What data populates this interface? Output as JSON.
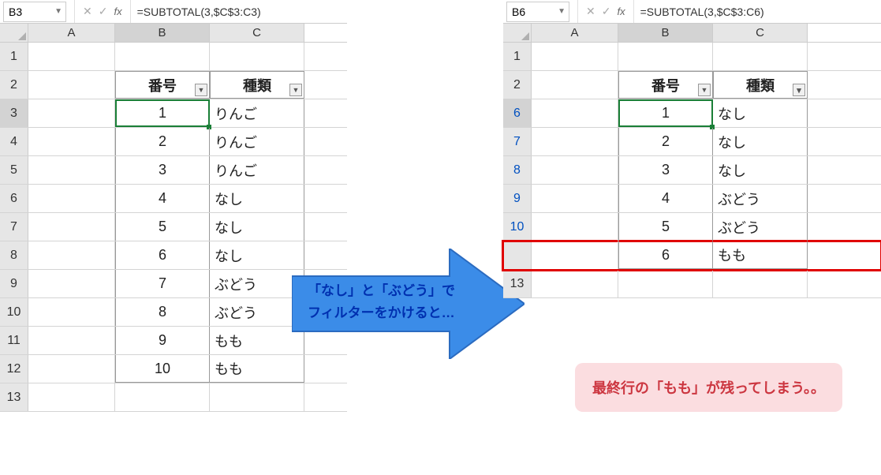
{
  "left": {
    "cellRef": "B3",
    "formula": "=SUBTOTAL(3,$C$3:C3)",
    "headers": {
      "num": "番号",
      "type": "種類"
    },
    "rows": [
      {
        "r": "3",
        "n": "1",
        "t": "りんご"
      },
      {
        "r": "4",
        "n": "2",
        "t": "りんご"
      },
      {
        "r": "5",
        "n": "3",
        "t": "りんご"
      },
      {
        "r": "6",
        "n": "4",
        "t": "なし"
      },
      {
        "r": "7",
        "n": "5",
        "t": "なし"
      },
      {
        "r": "8",
        "n": "6",
        "t": "なし"
      },
      {
        "r": "9",
        "n": "7",
        "t": "ぶどう"
      },
      {
        "r": "10",
        "n": "8",
        "t": "ぶどう"
      },
      {
        "r": "11",
        "n": "9",
        "t": "もも"
      },
      {
        "r": "12",
        "n": "10",
        "t": "もも"
      }
    ],
    "emptyRow": "13"
  },
  "right": {
    "cellRef": "B6",
    "formula": "=SUBTOTAL(3,$C$3:C6)",
    "headers": {
      "num": "番号",
      "type": "種類"
    },
    "rows": [
      {
        "r": "6",
        "n": "1",
        "t": "なし"
      },
      {
        "r": "7",
        "n": "2",
        "t": "なし"
      },
      {
        "r": "8",
        "n": "3",
        "t": "なし"
      },
      {
        "r": "9",
        "n": "4",
        "t": "ぶどう"
      },
      {
        "r": "10",
        "n": "5",
        "t": "ぶどう"
      }
    ],
    "extraRow": {
      "r": "",
      "n": "6",
      "t": "もも"
    },
    "afterRow": "13"
  },
  "cols": {
    "a": "A",
    "b": "B",
    "c": "C"
  },
  "row1": "1",
  "row2": "2",
  "arrowText1": "「なし」と「ぶどう」で",
  "arrowText2": "フィルターをかけると…",
  "callout": "最終行の「もも」が残ってしまう。。"
}
